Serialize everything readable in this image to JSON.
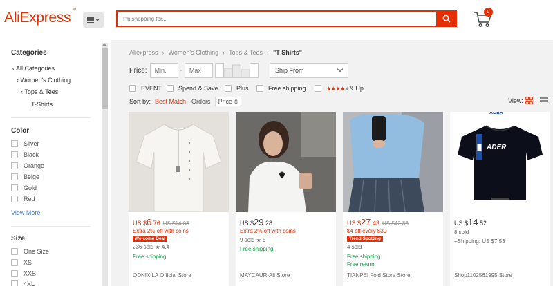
{
  "header": {
    "logo": "AliExpress",
    "logo_mark": "™",
    "search_placeholder": "I'm shopping for...",
    "cart_count": "0"
  },
  "sidebar": {
    "categories_title": "Categories",
    "category_links": [
      "All Categories",
      "Women's Clothing",
      "Tops & Tees",
      "T-Shirts"
    ],
    "color_title": "Color",
    "colors": [
      "Silver",
      "Black",
      "Orange",
      "Beige",
      "Gold",
      "Red"
    ],
    "view_more": "View More",
    "size_title": "Size",
    "sizes": [
      "One Size",
      "XS",
      "XXS",
      "4XL"
    ]
  },
  "breadcrumb": [
    "Aliexpress",
    "Women's Clothing",
    "Tops & Tees",
    "\"T-Shirts\""
  ],
  "filters": {
    "price_label": "Price:",
    "min_placeholder": "Min.",
    "max_placeholder": "Max",
    "ship_from": "Ship From",
    "checkbox_filters": [
      "EVENT",
      "Spend & Save",
      "Plus",
      "Free shipping"
    ],
    "rating_suffix": "& Up",
    "sort_label": "Sort by:",
    "sort_options": [
      "Best Match",
      "Orders",
      "Price"
    ],
    "view_label": "View:"
  },
  "products": [
    {
      "currency": "US $",
      "price_int": "6",
      "price_dec": ".76",
      "orig_price": "US $14.08",
      "promo": "Extra 2% off with coins",
      "badge": "Welcome Deal",
      "sold": "236 sold",
      "rating": "4.4",
      "shipping": "Free shipping",
      "extra": "",
      "store": "QDNIXILA Official Store"
    },
    {
      "currency": "US $",
      "price_int": "29",
      "price_dec": ".28",
      "orig_price": "",
      "promo": "Extra 2% off with coins",
      "badge": "",
      "sold": "9 sold",
      "rating": "5",
      "shipping": "Free shipping",
      "extra": "",
      "store": "MAYCAUR-Ali Store"
    },
    {
      "currency": "US $",
      "price_int": "27",
      "price_dec": ".43",
      "orig_price": "US $42.86",
      "promo": "$4 off every $30",
      "badge": "Trend Spotting",
      "sold": "4 sold",
      "rating": "",
      "shipping": "Free shipping",
      "extra": "Free return",
      "store": "TIANPEI Fold Store Store"
    },
    {
      "currency": "US $",
      "price_int": "14",
      "price_dec": ".52",
      "orig_price": "",
      "promo": "",
      "badge": "",
      "sold": "8 sold",
      "rating": "",
      "shipping": "+Shipping: US $7.53",
      "extra": "",
      "store": "Shop1102561995 Store",
      "brand_text": "ADER"
    }
  ],
  "colors": {
    "accent": "#e62e04",
    "green": "#1a9a4a",
    "link": "#4a7ec0"
  }
}
